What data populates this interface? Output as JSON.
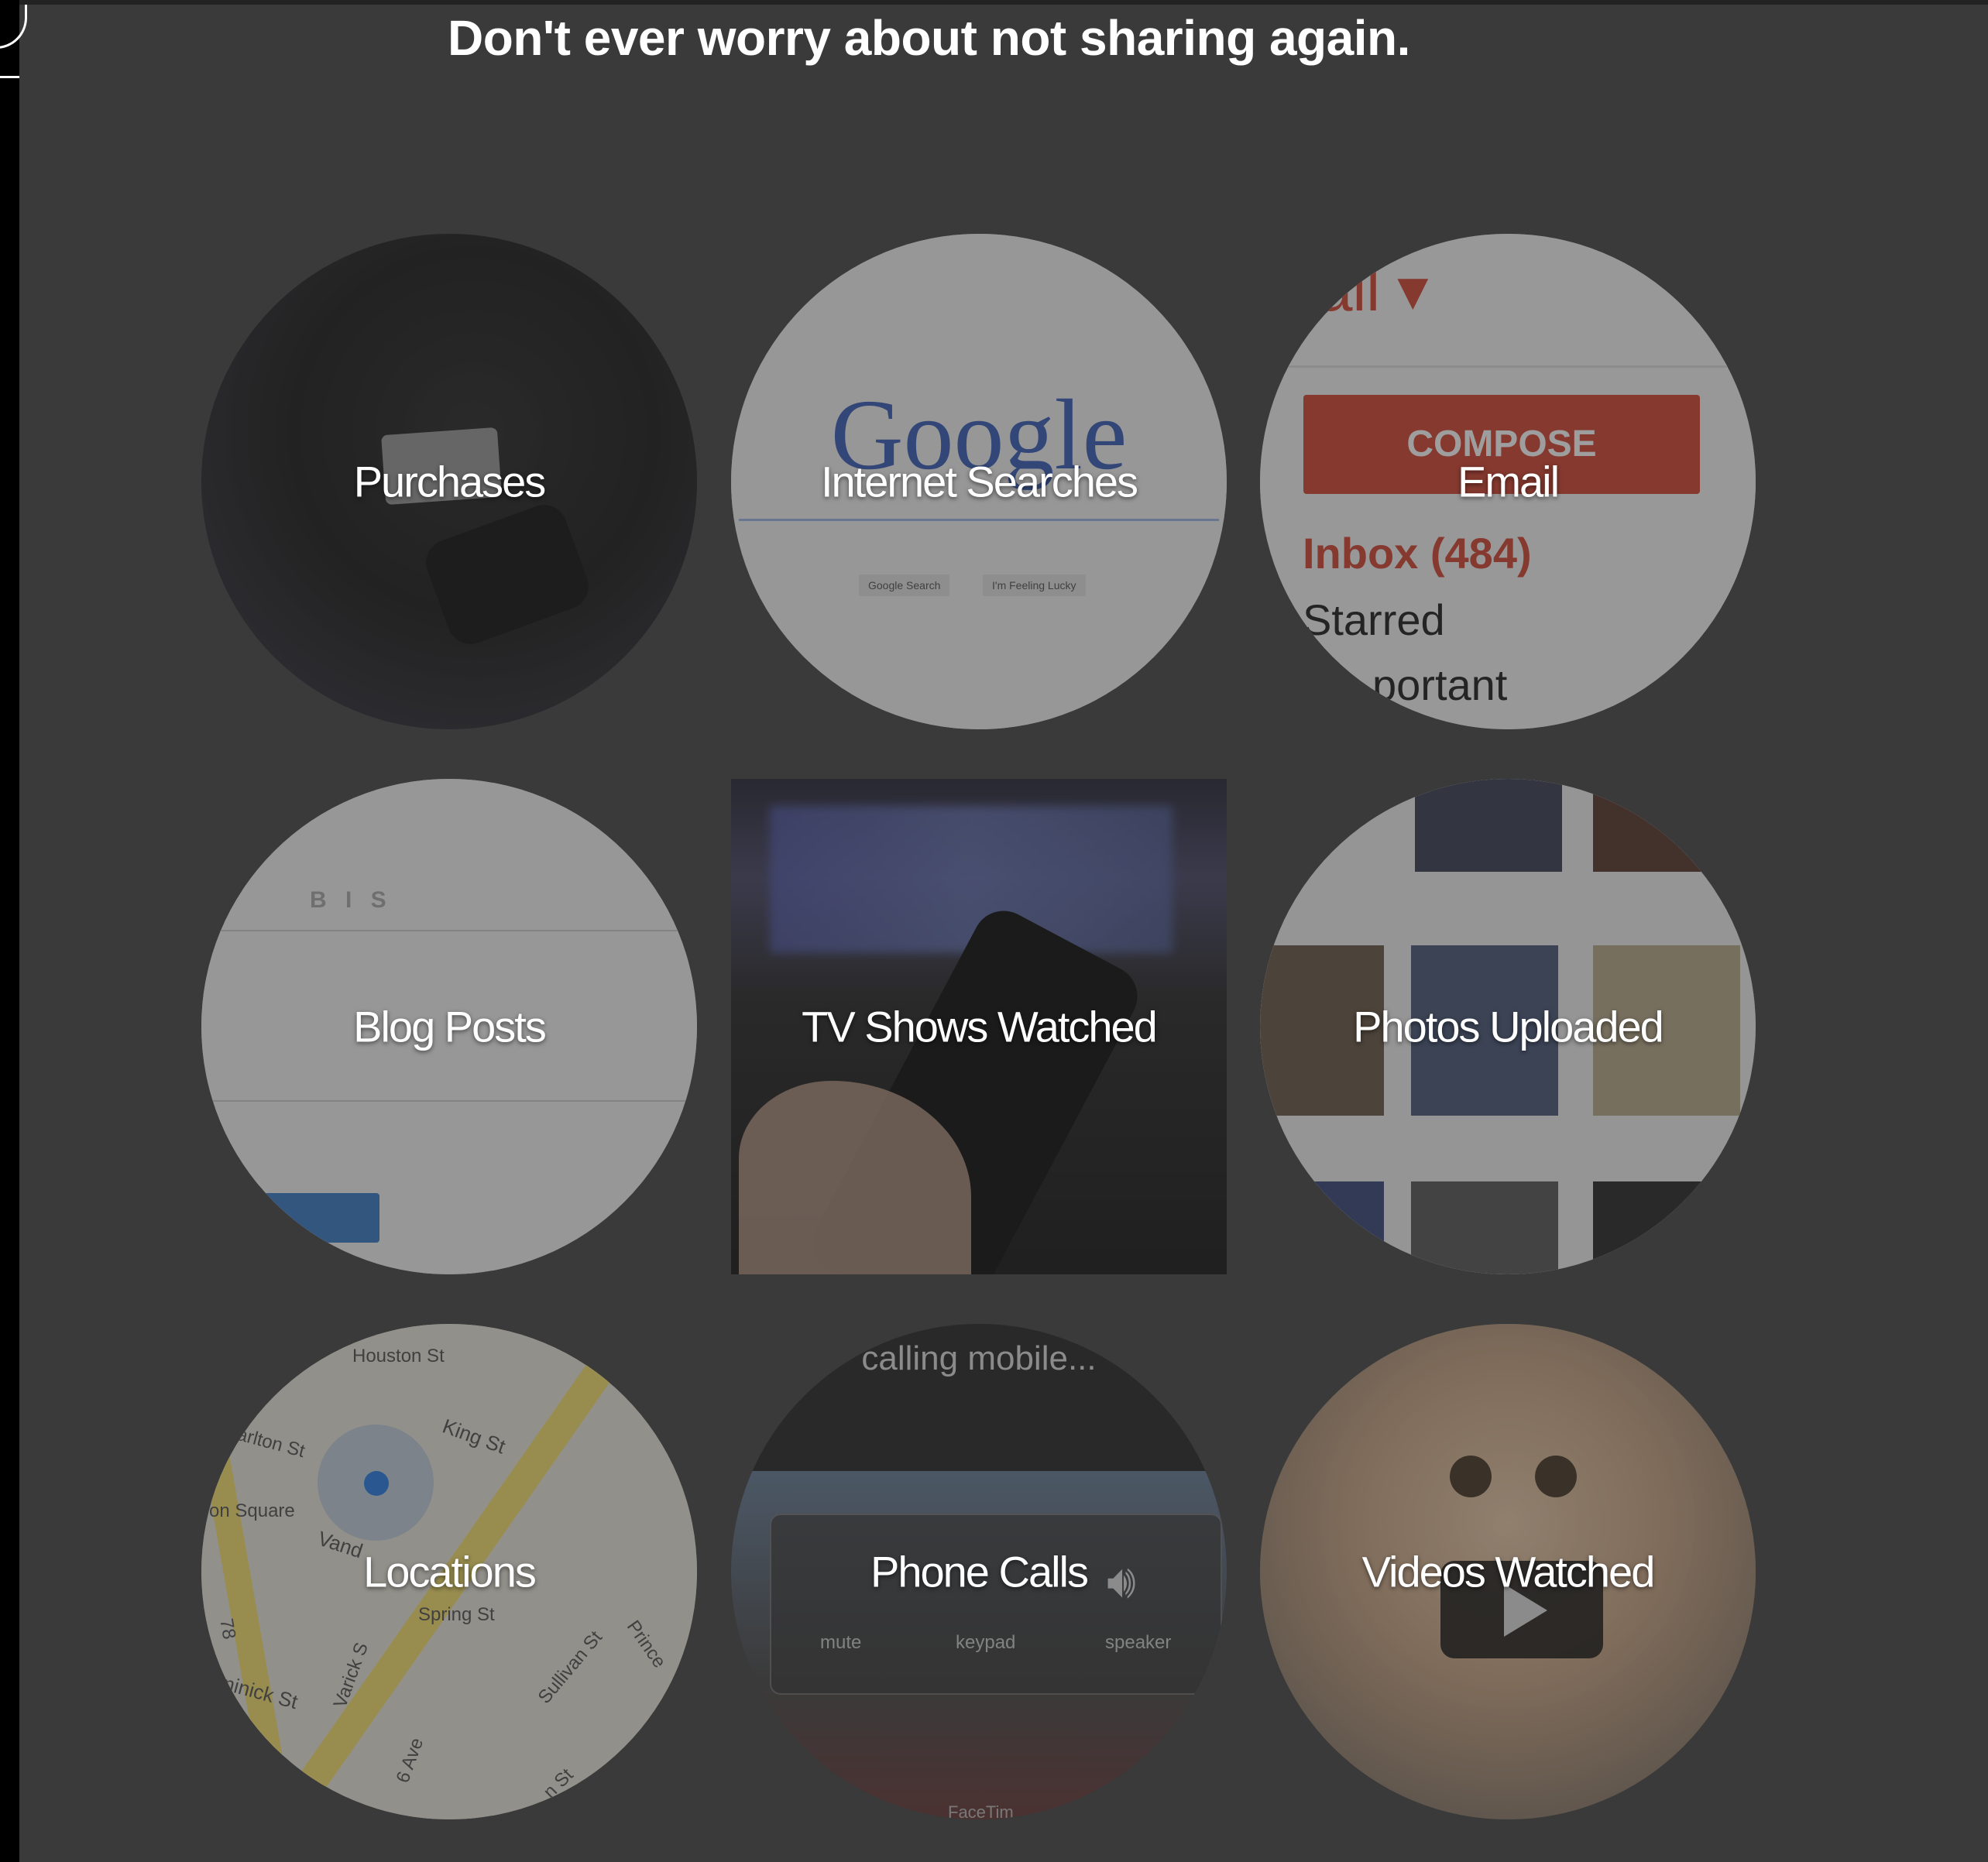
{
  "headline": "Don't ever worry about not sharing again.",
  "tiles": [
    {
      "label": "Purchases"
    },
    {
      "label": "Internet Searches",
      "brand": "Google",
      "btn1": "Google Search",
      "btn2": "I'm Feeling Lucky"
    },
    {
      "label": "Email",
      "top": "ail ▾",
      "compose": "COMPOSE",
      "inbox": "Inbox (484)",
      "starred": "Starred",
      "important": "portant"
    },
    {
      "label": "Blog Posts",
      "toolbar": "B  I  S"
    },
    {
      "label": "TV Shows Watched"
    },
    {
      "label": "Photos Uploaded"
    },
    {
      "label": "Locations",
      "streets": [
        "Houston St",
        "King St",
        "arlton St",
        "on Square",
        "Vand",
        "Spring St",
        "Varick S",
        "Sullivan St",
        "Prince",
        "minick St",
        "6 Ave",
        "78",
        "n St"
      ]
    },
    {
      "label": "Phone Calls",
      "calling": "calling mobile...",
      "mute": "mute",
      "keypad": "keypad",
      "speaker": "speaker",
      "facetime": "FaceTim"
    },
    {
      "label": "Videos Watched"
    }
  ]
}
